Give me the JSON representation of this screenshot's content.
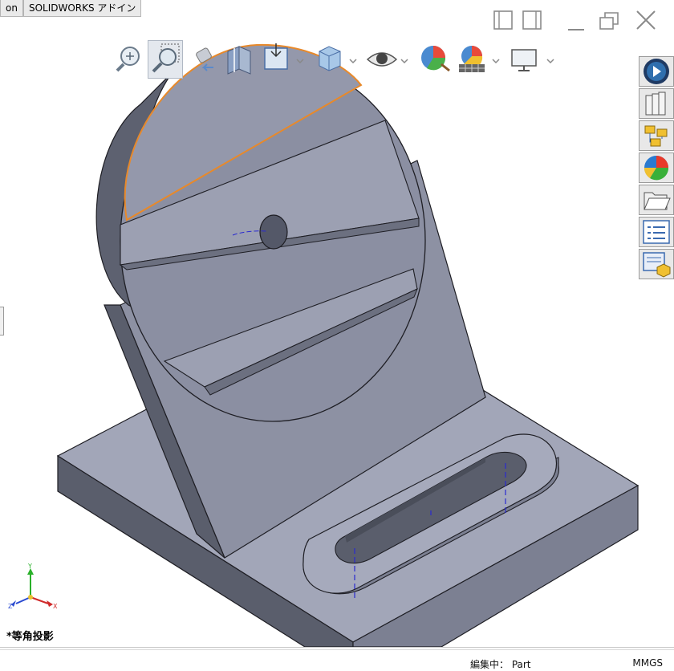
{
  "tabs": [
    {
      "label": "on"
    },
    {
      "label": "SOLIDWORKS アドイン"
    }
  ],
  "heads_up_toolbar": {
    "items": [
      {
        "icon": "zoom-to-fit-icon"
      },
      {
        "icon": "zoom-to-area-icon"
      },
      {
        "icon": "previous-view-icon"
      },
      {
        "icon": "section-view-icon"
      },
      {
        "icon": "view-orientation-icon"
      },
      {
        "icon": "display-style-icon"
      },
      {
        "icon": "hide-show-items-icon"
      },
      {
        "icon": "edit-appearance-icon"
      },
      {
        "icon": "apply-scene-icon"
      },
      {
        "icon": "view-settings-icon"
      }
    ]
  },
  "window_controls": [
    {
      "icon": "tile-left-icon"
    },
    {
      "icon": "tile-right-icon"
    },
    {
      "icon": "minimize-icon"
    },
    {
      "icon": "restore-icon"
    },
    {
      "icon": "close-icon"
    }
  ],
  "task_pane": [
    {
      "icon": "3dexperience-icon"
    },
    {
      "icon": "design-library-icon"
    },
    {
      "icon": "file-explorer-icon"
    },
    {
      "icon": "appearances-icon"
    },
    {
      "icon": "folder-icon"
    },
    {
      "icon": "custom-properties-icon"
    },
    {
      "icon": "view-palette-icon"
    }
  ],
  "triad": {
    "x": "X",
    "y": "Y",
    "z": "Z"
  },
  "view_name": "*等角投影",
  "status": {
    "mode": "編集中： Part",
    "units": "MMGS"
  },
  "colors": {
    "model_face": "#9196a8",
    "model_face_light": "#a7abbd",
    "model_face_dark": "#636777",
    "selection_edge": "#e8892a",
    "sketch_line": "#2a2ad0"
  }
}
